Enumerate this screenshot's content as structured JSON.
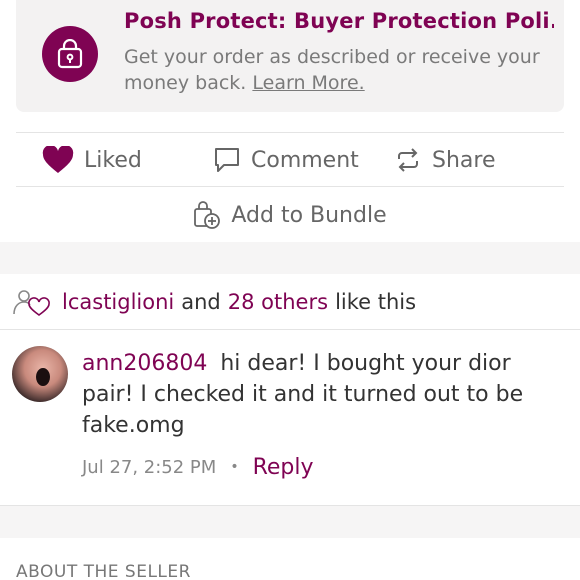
{
  "protect": {
    "title": "Posh Protect: Buyer Protection Poli...",
    "description": "Get your order as described or receive your money back.",
    "learn_more": "Learn More."
  },
  "actions": {
    "liked_label": "Liked",
    "comment_label": "Comment",
    "share_label": "Share",
    "bundle_label": "Add to Bundle"
  },
  "likes": {
    "user": "lcastiglioni",
    "and": "and",
    "others": "28 others",
    "suffix": "like this"
  },
  "comment": {
    "username": "ann206804",
    "text": "hi dear! I bought your dior pair! I checked it and it turned out to be fake.omg",
    "timestamp": "Jul 27, 2:52 PM",
    "separator": "•",
    "reply_label": "Reply"
  },
  "about": {
    "heading": "ABOUT THE SELLER"
  },
  "colors": {
    "brand": "#7f0353",
    "muted": "#666666"
  }
}
